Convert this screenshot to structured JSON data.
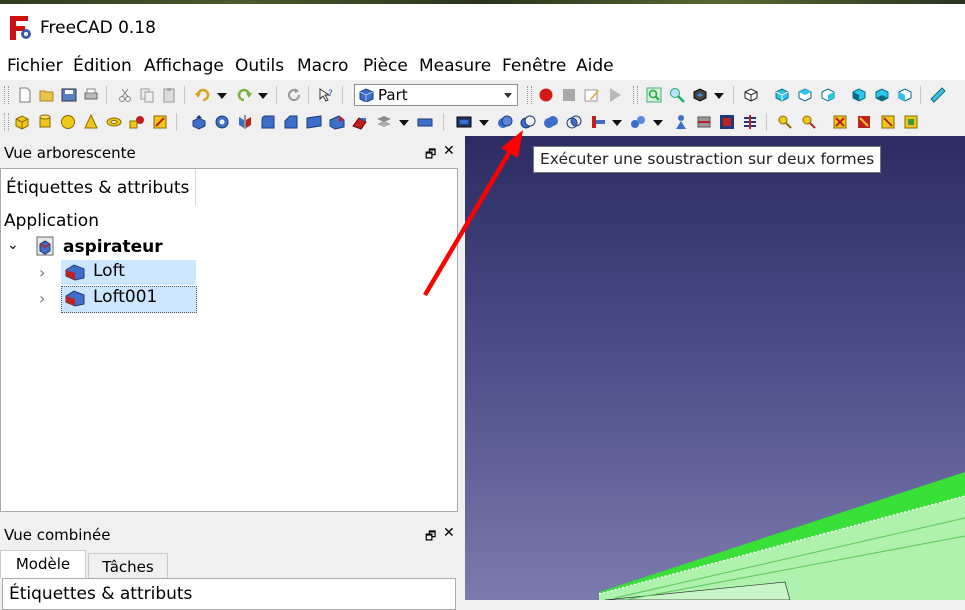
{
  "window": {
    "title": "FreeCAD 0.18",
    "logo_letter": "F"
  },
  "menu": [
    "Fichier",
    "Édition",
    "Affichage",
    "Outils",
    "Macro",
    "Pièce",
    "Measure",
    "Fenêtre",
    "Aide"
  ],
  "toolbar": {
    "workbench": "Part"
  },
  "tooltip": "Exécuter une soustraction sur deux formes",
  "tree_view": {
    "title": "Vue arborescente",
    "tab": "Étiquettes & attributs",
    "section": "Application",
    "document": "aspirateur",
    "items": [
      "Loft",
      "Loft001"
    ]
  },
  "combo_view": {
    "title": "Vue combinée",
    "tabs": [
      "Modèle",
      "Tâches"
    ],
    "content": "Étiquettes & attributs"
  },
  "colors": {
    "annotation_arrow": "#ff0000",
    "viewport_top": "#2c2c62",
    "viewport_bottom": "#7b7bad",
    "shape_green": "#38e038",
    "selection": "#cce6ff"
  }
}
